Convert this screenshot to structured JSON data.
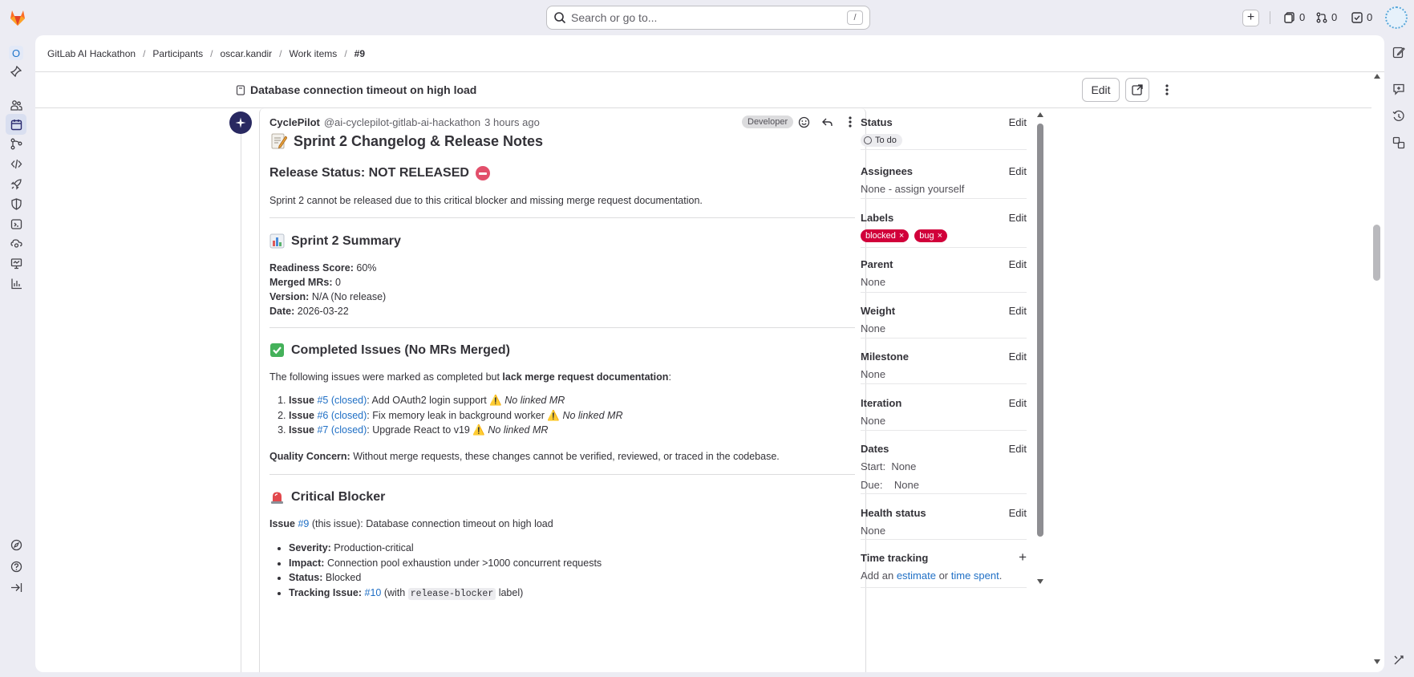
{
  "topbar": {
    "search_placeholder": "Search or go to...",
    "search_shortcut": "/",
    "issues_count": "0",
    "mr_count": "0",
    "todo_count": "0"
  },
  "rail": {
    "org_letter": "O"
  },
  "breadcrumb": [
    "GitLab AI Hackathon",
    "Participants",
    "oscar.kandir",
    "Work items",
    "#9"
  ],
  "work_item": {
    "title": "Database connection timeout on high load",
    "edit_label": "Edit"
  },
  "note": {
    "author": "CyclePilot",
    "handle": "@ai-cyclepilot-gitlab-ai-hackathon",
    "time": "3 hours ago",
    "role": "Developer",
    "heading": "Sprint 2 Changelog & Release Notes",
    "release_status_heading": "Release Status: NOT RELEASED",
    "release_status_text": "Sprint 2 cannot be released due to this critical blocker and missing merge request documentation.",
    "summary_heading": "Sprint 2 Summary",
    "summary": [
      {
        "label": "Readiness Score:",
        "value": "60%"
      },
      {
        "label": "Merged MRs:",
        "value": "0"
      },
      {
        "label": "Version:",
        "value": "N/A (No release)"
      },
      {
        "label": "Date:",
        "value": "2026-03-22"
      }
    ],
    "completed_heading": "Completed Issues (No MRs Merged)",
    "completed_intro_pre": "The following issues were marked as completed but ",
    "completed_intro_bold": "lack merge request documentation",
    "completed_intro_post": ":",
    "completed_items": [
      {
        "prefix": "Issue",
        "link": "#5 (closed)",
        "text": ": Add OAuth2 login support",
        "flag": "No linked MR"
      },
      {
        "prefix": "Issue",
        "link": "#6 (closed)",
        "text": ": Fix memory leak in background worker",
        "flag": "No linked MR"
      },
      {
        "prefix": "Issue",
        "link": "#7 (closed)",
        "text": ": Upgrade React to v19",
        "flag": "No linked MR"
      }
    ],
    "quality_label": "Quality Concern:",
    "quality_text": " Without merge requests, these changes cannot be verified, reviewed, or traced in the codebase.",
    "blocker_heading": "Critical Blocker",
    "blocker_issue_prefix": "Issue",
    "blocker_issue_link": "#9",
    "blocker_issue_text": " (this issue): Database connection timeout on high load",
    "blocker_items": [
      {
        "label": "Severity:",
        "value": "Production-critical"
      },
      {
        "label": "Impact:",
        "value": "Connection pool exhaustion under >1000 concurrent requests"
      },
      {
        "label": "Status:",
        "value": "Blocked"
      }
    ],
    "tracking_label": "Tracking Issue:",
    "tracking_link": "#10",
    "tracking_pre": " (with ",
    "tracking_code": "release-blocker",
    "tracking_post": " label)"
  },
  "sidebar": {
    "edit": "Edit",
    "status_label": "Status",
    "status_value": "To do",
    "assignees_label": "Assignees",
    "assignees_value": "None - assign yourself",
    "labels_label": "Labels",
    "labels": [
      "blocked",
      "bug"
    ],
    "parent_label": "Parent",
    "parent_value": "None",
    "weight_label": "Weight",
    "weight_value": "None",
    "milestone_label": "Milestone",
    "milestone_value": "None",
    "iteration_label": "Iteration",
    "iteration_value": "None",
    "dates_label": "Dates",
    "start_label": "Start:",
    "start_value": "None",
    "due_label": "Due:",
    "due_value": "None",
    "health_label": "Health status",
    "health_value": "None",
    "time_label": "Time tracking",
    "time_pre": "Add an ",
    "time_estimate": "estimate",
    "time_mid": " or ",
    "time_spent": "time spent",
    "time_post": "."
  },
  "colors": {
    "label_red": "#d1003a",
    "link_blue": "#1f6fc5",
    "bot_avatar": "#292961"
  }
}
